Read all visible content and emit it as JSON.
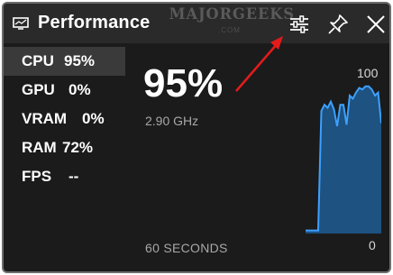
{
  "window": {
    "title": "Performance",
    "watermark": "MAJORGEEKS",
    "watermark_sub": ".COM"
  },
  "titlebar": {
    "icons": [
      "monitor-icon",
      "settings-sliders-icon",
      "pin-icon",
      "close-icon"
    ]
  },
  "metrics": [
    {
      "name": "CPU",
      "value": "95%",
      "selected": true
    },
    {
      "name": "GPU",
      "value": "0%",
      "selected": false
    },
    {
      "name": "VRAM",
      "value": "0%",
      "selected": false
    },
    {
      "name": "RAM",
      "value": "72%",
      "selected": false
    },
    {
      "name": "FPS",
      "value": "--",
      "selected": false
    }
  ],
  "detail": {
    "value": "95%",
    "frequency": "2.90 GHz",
    "duration": "60 SECONDS",
    "y_max": "100",
    "y_min": "0"
  },
  "colors": {
    "accent": "#1f7fd6",
    "annotation_arrow": "#e31b1b",
    "background": "#1b1b1b"
  },
  "chart_data": {
    "type": "area",
    "ylim": [
      0,
      100
    ],
    "values": [
      2,
      2,
      2,
      2,
      2,
      80,
      84,
      82,
      86,
      81,
      70,
      84,
      84,
      71,
      90,
      88,
      92,
      95,
      94,
      96,
      96,
      94,
      90,
      92,
      72
    ]
  }
}
